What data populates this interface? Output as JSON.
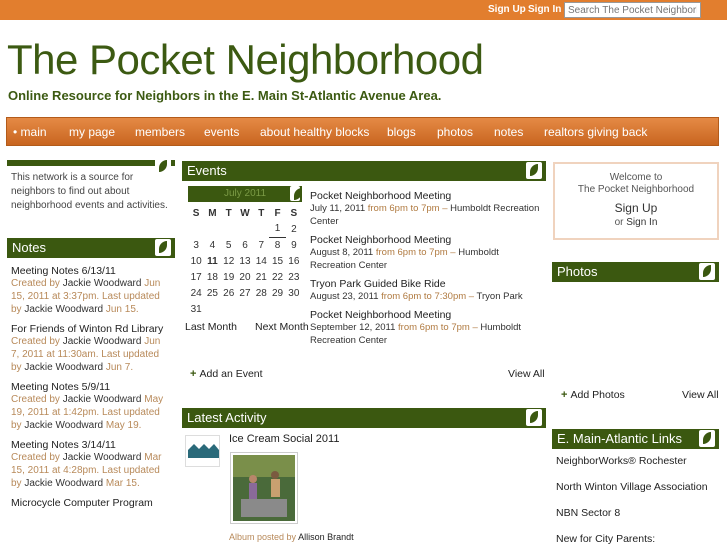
{
  "topbar": {
    "signup": "Sign Up",
    "signin": "Sign In",
    "search_placeholder": "Search The Pocket Neighborhood"
  },
  "site": {
    "title": "The Pocket Neighborhood",
    "subtitle": "Online Resource for Neighbors in the E. Main St-Atlantic Avenue Area."
  },
  "nav": {
    "items": [
      "• main",
      "my page",
      "members",
      "events",
      "about healthy blocks",
      "blogs",
      "photos",
      "notes",
      "realtors giving back"
    ]
  },
  "about": {
    "text": "This network is a source for neighbors to find out about neighborhood events and activities."
  },
  "notes": {
    "heading": "Notes",
    "items": [
      {
        "title": "Meeting Notes 6/13/11",
        "created": "Created by",
        "author": "Jackie Woodward",
        "date1": "Jun 15, 2011 at 3:37pm.",
        "updated": "Last updated by",
        "author2": "Jackie Woodward",
        "date2": "Jun 15."
      },
      {
        "title": "For Friends of Winton Rd Library",
        "created": "Created by",
        "author": "Jackie Woodward",
        "date1": "Jun 7, 2011 at 11:30am.",
        "updated": "Last updated by",
        "author2": "Jackie Woodward",
        "date2": "Jun 7."
      },
      {
        "title": "Meeting Notes 5/9/11",
        "created": "Created by",
        "author": "Jackie Woodward",
        "date1": "May 19, 2011 at 1:42pm.",
        "updated": "Last updated by",
        "author2": "Jackie Woodward",
        "date2": "May 19."
      },
      {
        "title": "Meeting Notes 3/14/11",
        "created": "Created by",
        "author": "Jackie Woodward",
        "date1": "Mar 15, 2011 at 4:28pm.",
        "updated": "Last updated by",
        "author2": "Jackie Woodward",
        "date2": "Mar 15."
      },
      {
        "title": "Microcycle Computer Program"
      }
    ]
  },
  "events": {
    "heading": "Events",
    "calendar": {
      "month": "July 2011",
      "days": [
        "S",
        "M",
        "T",
        "W",
        "T",
        "F",
        "S"
      ],
      "weeks": [
        [
          "",
          "",
          "",
          "",
          "",
          "1",
          "2"
        ],
        [
          "3",
          "4",
          "5",
          "6",
          "7",
          "8",
          "9"
        ],
        [
          "10",
          "11",
          "12",
          "13",
          "14",
          "15",
          "16"
        ],
        [
          "17",
          "18",
          "19",
          "20",
          "21",
          "22",
          "23"
        ],
        [
          "24",
          "25",
          "26",
          "27",
          "28",
          "29",
          "30"
        ],
        [
          "31",
          "",
          "",
          "",
          "",
          "",
          ""
        ]
      ],
      "prev": "Last Month",
      "next": "Next Month"
    },
    "list": [
      {
        "title": "Pocket Neighborhood Meeting",
        "date": "July 11, 2011",
        "time": "from 6pm to 7pm –",
        "place": "Humboldt Recreation Center"
      },
      {
        "title": "Pocket Neighborhood Meeting",
        "date": "August 8, 2011",
        "time": "from 6pm to 7pm –",
        "place": "Humboldt Recreation Center"
      },
      {
        "title": "Tryon Park Guided Bike Ride",
        "date": "August 23, 2011",
        "time": "from 6pm to 7:30pm –",
        "place": "Tryon Park"
      },
      {
        "title": "Pocket Neighborhood Meeting",
        "date": "September 12, 2011",
        "time": "from 6pm to 7pm –",
        "place": "Humboldt Recreation Center"
      }
    ],
    "add": "Add an Event",
    "viewall": "View All"
  },
  "activity": {
    "heading": "Latest Activity",
    "item_title": "Ice Cream Social 2011",
    "posted": "Album posted by",
    "poster": "Allison Brandt"
  },
  "welcome": {
    "line1": "Welcome to",
    "line2": "The Pocket Neighborhood",
    "signup": "Sign Up",
    "or": "or",
    "signin": "Sign In"
  },
  "photos": {
    "heading": "Photos",
    "add": "Add Photos",
    "viewall": "View All"
  },
  "links": {
    "heading": "E. Main-Atlantic Links",
    "items": [
      "NeighborWorks® Rochester",
      "North Winton Village Association",
      "NBN Sector 8",
      "New for City Parents:"
    ]
  },
  "colors": {
    "accent": "#e27e2e",
    "header_green": "#3b5810",
    "title_green": "#3c5a12"
  }
}
